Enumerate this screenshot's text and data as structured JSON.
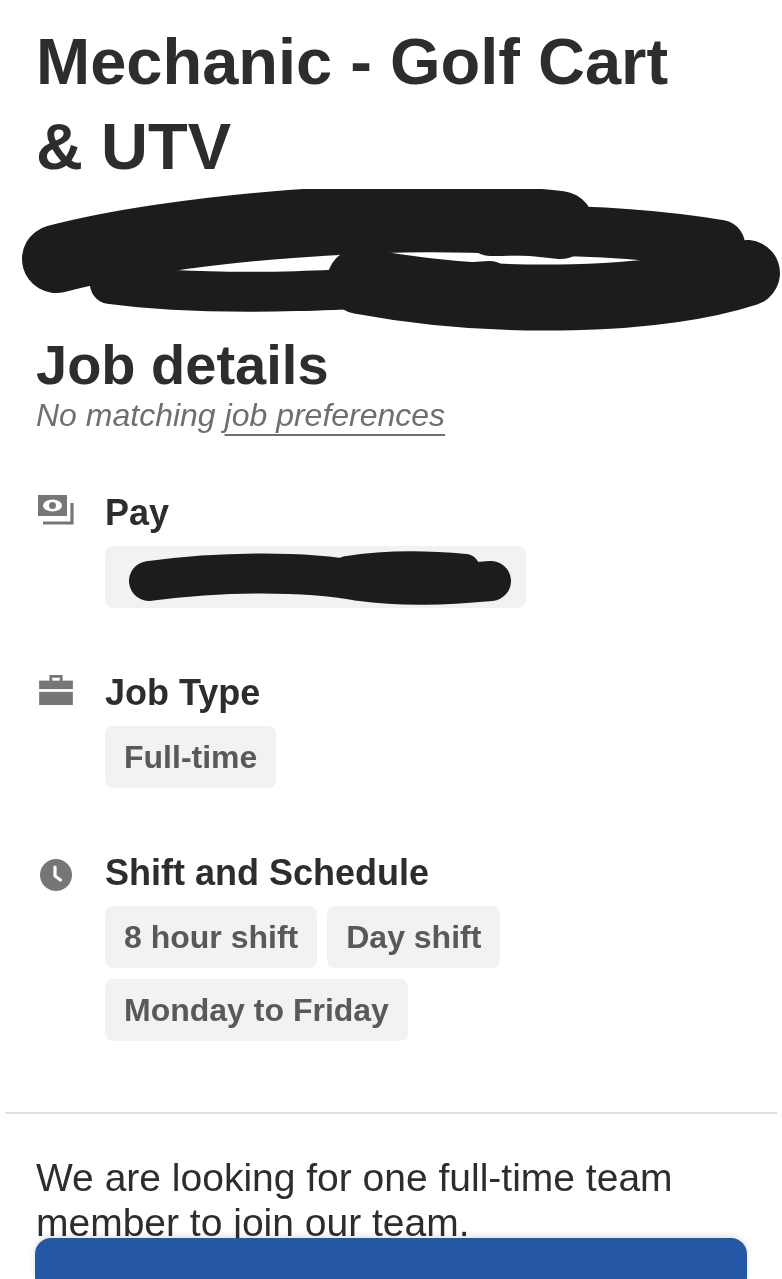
{
  "job_title": "Mechanic - Golf Cart & UTV",
  "company": {
    "redacted": true
  },
  "job_details": {
    "heading": "Job details",
    "preferences_note": {
      "text": "No matching",
      "link": "job preferences"
    },
    "sections": [
      {
        "kind": "pay",
        "label": "Pay",
        "tags": [
          {
            "redacted": true
          }
        ]
      },
      {
        "kind": "job_type",
        "label": "Job Type",
        "tags": [
          {
            "text": "Full-time",
            "redacted": false
          }
        ]
      },
      {
        "kind": "schedule",
        "label": "Shift and Schedule",
        "tags": [
          {
            "text": "8 hour shift",
            "redacted": false
          },
          {
            "text": "Day shift",
            "redacted": false
          },
          {
            "text": "Monday to Friday",
            "redacted": false
          }
        ]
      }
    ]
  },
  "description": {
    "text": "We are looking for one full-time team member to join our team."
  }
}
